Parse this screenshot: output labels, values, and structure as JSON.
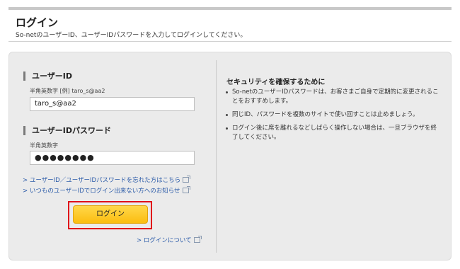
{
  "header": {
    "title": "ログイン",
    "subtitle": "So-netのユーザーID、ユーザーIDパスワードを入力してログインしてください。"
  },
  "form": {
    "userid": {
      "heading": "ユーザーID",
      "hint": "半角英数字 [例] taro_s@aa2",
      "value": "taro_s@aa2"
    },
    "password": {
      "heading": "ユーザーIDパスワード",
      "hint": "半角英数字",
      "value": "●●●●●●●●"
    },
    "links": {
      "forgot": "> ユーザーID／ユーザーIDパスワードを忘れた方はこちら",
      "cannot_login": "> いつものユーザーIDでログイン出来ない方へのお知らせ",
      "about_login": "> ログインについて"
    },
    "login_button": "ログイン",
    "highlight_color": "#e0101a"
  },
  "security": {
    "title": "セキュリティを確保するために",
    "items": [
      "So-netのユーザーIDパスワードは、お客さまご自身で定期的に変更されることをおすすめします。",
      "同じID、パスワードを複数のサイトで使い回すことは止めましょう。",
      "ログイン後に席を離れるなどしばらく操作しない場合は、一旦ブラウザを終了してください。"
    ]
  },
  "colors": {
    "button_gradient_top": "#ffd84a",
    "button_gradient_bottom": "#fbbd10",
    "link": "#2a5aa8",
    "panel_bg": "#ebebeb"
  },
  "icons": {
    "external_link": "external-link-icon",
    "bullet": "bullet-dot-icon"
  }
}
